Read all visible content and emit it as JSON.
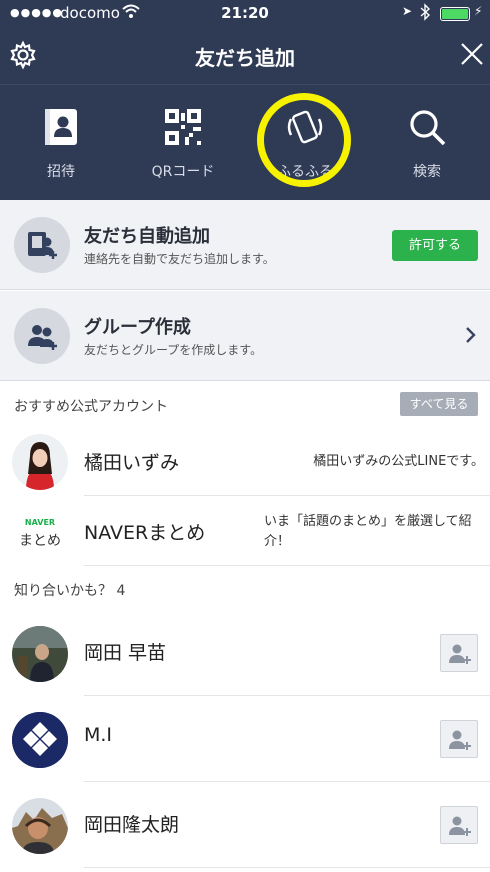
{
  "status": {
    "carrier": "docomo",
    "time": "21:20"
  },
  "nav": {
    "title": "友だち追加"
  },
  "tabs": [
    {
      "label": "招待",
      "icon": "contacts-icon"
    },
    {
      "label": "QRコード",
      "icon": "qr-code-icon"
    },
    {
      "label": "ふるふる",
      "icon": "shake-phone-icon"
    },
    {
      "label": "検索",
      "icon": "search-icon"
    }
  ],
  "auto_add": {
    "title": "友だち自動追加",
    "subtitle": "連絡先を自動で友だち追加します。",
    "button": "許可する"
  },
  "group": {
    "title": "グループ作成",
    "subtitle": "友だちとグループを作成します。"
  },
  "official": {
    "heading": "おすすめ公式アカウント",
    "see_all": "すべて見る",
    "items": [
      {
        "name": "橘田いずみ",
        "description": "橘田いずみの公式LINEです。"
      },
      {
        "name": "NAVERまとめ",
        "logo_top": "NAVER",
        "logo_bottom": "まとめ",
        "description": "いま「話題のまとめ」を厳選して紹介！"
      }
    ]
  },
  "suggest": {
    "heading": "知り合いかも？ 4",
    "items": [
      {
        "name": "岡田 早苗"
      },
      {
        "name": "M.I"
      },
      {
        "name": "岡田隆太朗"
      }
    ]
  },
  "colors": {
    "header_bg": "#2f3a55",
    "accent_green": "#2bb24c",
    "highlight": "#f7f300"
  }
}
